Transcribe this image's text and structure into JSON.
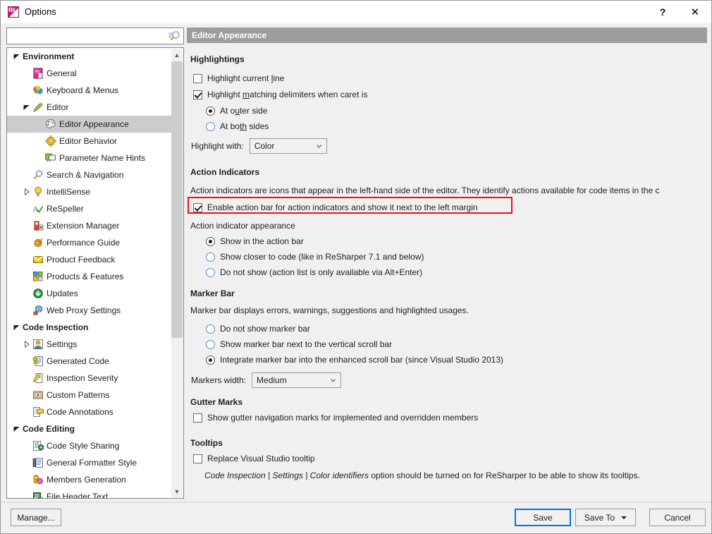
{
  "window": {
    "title": "Options",
    "app_icon": "resharper-icon",
    "help_label": "?",
    "close_label": "✕"
  },
  "search": {
    "value": "",
    "placeholder": "",
    "icon": "search-settings-icon"
  },
  "tree": {
    "items": [
      {
        "label": "Environment",
        "level": 0,
        "twisty": "expanded",
        "icon": "none",
        "bold": true,
        "selected": false
      },
      {
        "label": "General",
        "level": 1,
        "twisty": "none",
        "icon": "resharper-icon",
        "bold": false,
        "selected": false
      },
      {
        "label": "Keyboard & Menus",
        "level": 1,
        "twisty": "none",
        "icon": "keyboard-menus-icon",
        "bold": false,
        "selected": false
      },
      {
        "label": "Editor",
        "level": 1,
        "twisty": "expanded",
        "icon": "pencil-icon",
        "bold": false,
        "selected": false
      },
      {
        "label": "Editor Appearance",
        "level": 2,
        "twisty": "none",
        "icon": "palette-icon",
        "bold": false,
        "selected": true
      },
      {
        "label": "Editor Behavior",
        "level": 2,
        "twisty": "none",
        "icon": "gear-icon",
        "bold": false,
        "selected": false
      },
      {
        "label": "Parameter Name Hints",
        "level": 2,
        "twisty": "none",
        "icon": "hints-icon",
        "bold": false,
        "selected": false
      },
      {
        "label": "Search & Navigation",
        "level": 1,
        "twisty": "none",
        "icon": "magnifier-icon",
        "bold": false,
        "selected": false
      },
      {
        "label": "IntelliSense",
        "level": 1,
        "twisty": "collapsed",
        "icon": "lightbulb-icon",
        "bold": false,
        "selected": false
      },
      {
        "label": "ReSpeller",
        "level": 1,
        "twisty": "none",
        "icon": "respeller-icon",
        "bold": false,
        "selected": false
      },
      {
        "label": "Extension Manager",
        "level": 1,
        "twisty": "none",
        "icon": "extension-icon",
        "bold": false,
        "selected": false
      },
      {
        "label": "Performance Guide",
        "level": 1,
        "twisty": "none",
        "icon": "snail-icon",
        "bold": false,
        "selected": false
      },
      {
        "label": "Product Feedback",
        "level": 1,
        "twisty": "none",
        "icon": "envelope-icon",
        "bold": false,
        "selected": false
      },
      {
        "label": "Products & Features",
        "level": 1,
        "twisty": "none",
        "icon": "products-icon",
        "bold": false,
        "selected": false
      },
      {
        "label": "Updates",
        "level": 1,
        "twisty": "none",
        "icon": "updates-icon",
        "bold": false,
        "selected": false
      },
      {
        "label": "Web Proxy Settings",
        "level": 1,
        "twisty": "none",
        "icon": "globe-icon",
        "bold": false,
        "selected": false
      },
      {
        "label": "Code Inspection",
        "level": 0,
        "twisty": "expanded",
        "icon": "none",
        "bold": true,
        "selected": false
      },
      {
        "label": "Settings",
        "level": 1,
        "twisty": "collapsed",
        "icon": "settings-person-icon",
        "bold": false,
        "selected": false
      },
      {
        "label": "Generated Code",
        "level": 1,
        "twisty": "none",
        "icon": "generated-code-icon",
        "bold": false,
        "selected": false
      },
      {
        "label": "Inspection Severity",
        "level": 1,
        "twisty": "none",
        "icon": "severity-icon",
        "bold": false,
        "selected": false
      },
      {
        "label": "Custom Patterns",
        "level": 1,
        "twisty": "none",
        "icon": "patterns-icon",
        "bold": false,
        "selected": false
      },
      {
        "label": "Code Annotations",
        "level": 1,
        "twisty": "none",
        "icon": "annotations-icon",
        "bold": false,
        "selected": false
      },
      {
        "label": "Code Editing",
        "level": 0,
        "twisty": "expanded",
        "icon": "none",
        "bold": true,
        "selected": false
      },
      {
        "label": "Code Style Sharing",
        "level": 1,
        "twisty": "none",
        "icon": "style-sharing-icon",
        "bold": false,
        "selected": false
      },
      {
        "label": "General Formatter Style",
        "level": 1,
        "twisty": "none",
        "icon": "formatter-icon",
        "bold": false,
        "selected": false
      },
      {
        "label": "Members Generation",
        "level": 1,
        "twisty": "none",
        "icon": "members-icon",
        "bold": false,
        "selected": false
      },
      {
        "label": "File Header Text",
        "level": 1,
        "twisty": "none",
        "icon": "file-header-icon",
        "bold": false,
        "selected": false
      }
    ]
  },
  "page": {
    "header": "Editor Appearance",
    "highlightings": {
      "title": "Highlightings",
      "highlight_current_line": {
        "label": "Highlight current line",
        "checked": false
      },
      "highlight_matching": {
        "label": "Highlight matching delimiters when caret is",
        "checked": true
      },
      "caret_options": [
        {
          "label": "At outer side",
          "selected": true
        },
        {
          "label": "At both sides",
          "selected": false
        }
      ],
      "highlight_with_label": "Highlight with:",
      "highlight_with_value": "Color"
    },
    "action_indicators": {
      "title": "Action Indicators",
      "description": "Action indicators are icons that appear in the left-hand side of the editor. They identify actions available for code items in the c",
      "enable_action_bar": {
        "label": "Enable action bar for action indicators and show it next to the left margin",
        "checked": true,
        "highlighted": true
      },
      "appearance_label": "Action indicator appearance",
      "appearance_options": [
        {
          "label": "Show in the action bar",
          "selected": true
        },
        {
          "label": "Show closer to code (like in ReSharper 7.1 and below)",
          "selected": false
        },
        {
          "label": "Do not show (action list is only available via Alt+Enter)",
          "selected": false
        }
      ]
    },
    "marker_bar": {
      "title": "Marker Bar",
      "description": "Marker bar displays errors, warnings, suggestions and highlighted usages.",
      "options": [
        {
          "label": "Do not show marker bar",
          "selected": false
        },
        {
          "label": "Show marker bar next to the vertical scroll bar",
          "selected": false
        },
        {
          "label": "Integrate marker bar into the enhanced scroll bar (since Visual Studio 2013)",
          "selected": true
        }
      ],
      "markers_width_label": "Markers width:",
      "markers_width_value": "Medium"
    },
    "gutter_marks": {
      "title": "Gutter Marks",
      "show_gutter": {
        "label": "Show gutter navigation marks for implemented and overridden members",
        "checked": false
      }
    },
    "tooltips": {
      "title": "Tooltips",
      "replace_tooltip": {
        "label": "Replace Visual Studio tooltip",
        "checked": false
      },
      "note_italic": "Code Inspection | Settings | Color identifiers",
      "note_rest": " option should be turned on for ReSharper to be able to show its tooltips."
    }
  },
  "footer": {
    "manage": "Manage...",
    "save": "Save",
    "save_to": "Save To",
    "cancel": "Cancel"
  },
  "colors": {
    "accent": "#0078d7",
    "highlight_box": "#ee1111",
    "header_bar": "#9d9d9d",
    "selection": "#cccccc"
  }
}
